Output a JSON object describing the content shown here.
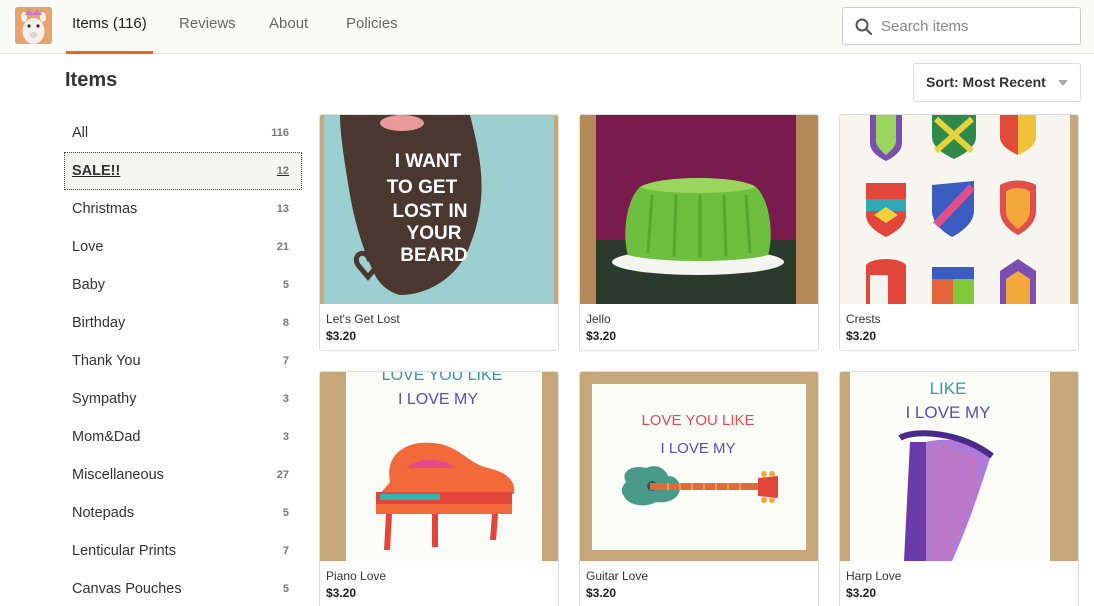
{
  "nav": {
    "tabs": [
      {
        "label": "Items (116)"
      },
      {
        "label": "Reviews"
      },
      {
        "label": "About"
      },
      {
        "label": "Policies"
      }
    ],
    "search_placeholder": "Search items"
  },
  "main": {
    "title": "Items",
    "sort_label": "Sort: Most Recent"
  },
  "sidebar": {
    "categories": [
      {
        "name": "All",
        "count": "116"
      },
      {
        "name": "SALE!!",
        "count": "12"
      },
      {
        "name": "Christmas",
        "count": "13"
      },
      {
        "name": "Love",
        "count": "21"
      },
      {
        "name": "Baby",
        "count": "5"
      },
      {
        "name": "Birthday",
        "count": "8"
      },
      {
        "name": "Thank You",
        "count": "7"
      },
      {
        "name": "Sympathy",
        "count": "3"
      },
      {
        "name": "Mom&Dad",
        "count": "3"
      },
      {
        "name": "Miscellaneous",
        "count": "27"
      },
      {
        "name": "Notepads",
        "count": "5"
      },
      {
        "name": "Lenticular Prints",
        "count": "7"
      },
      {
        "name": "Canvas Pouches",
        "count": "5"
      }
    ]
  },
  "items": [
    {
      "title": "Let's Get Lost",
      "price": "$3.20",
      "art_text": [
        "I WANT",
        "TO GET",
        "LOST IN",
        "YOUR",
        "BEARD"
      ]
    },
    {
      "title": "Jello",
      "price": "$3.20"
    },
    {
      "title": "Crests",
      "price": "$3.20"
    },
    {
      "title": "Piano Love",
      "price": "$3.20",
      "art_text": [
        "LOVE YOU LIKE",
        "I LOVE MY"
      ]
    },
    {
      "title": "Guitar Love",
      "price": "$3.20",
      "art_text": [
        "LOVE YOU LIKE",
        "I LOVE MY"
      ]
    },
    {
      "title": "Harp Love",
      "price": "$3.20",
      "art_text": [
        "LIKE",
        "I LOVE MY"
      ]
    }
  ],
  "colors": {
    "accent": "#f1641e"
  }
}
